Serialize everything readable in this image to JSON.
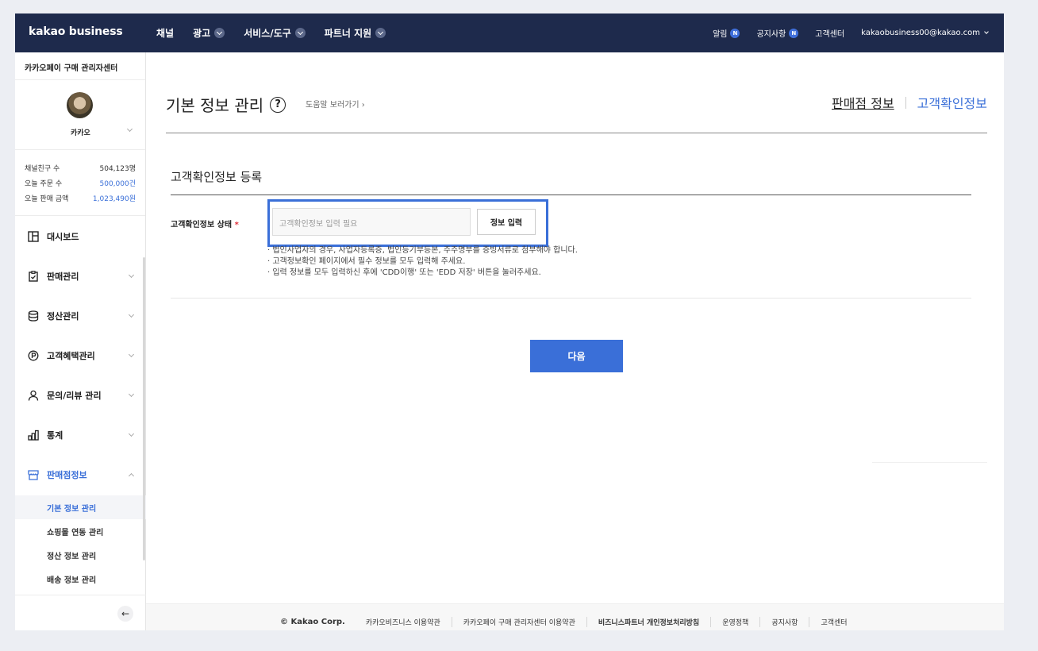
{
  "topnav": {
    "logo": "kakao business",
    "menu": [
      {
        "label": "채널",
        "has_dropdown": false
      },
      {
        "label": "광고",
        "has_dropdown": true
      },
      {
        "label": "서비스/도구",
        "has_dropdown": true
      },
      {
        "label": "파트너 지원",
        "has_dropdown": true
      }
    ],
    "right": {
      "alert": "알림",
      "notice": "공지사항",
      "badge": "N",
      "support": "고객센터",
      "account": "kakaobusiness00@kakao.com"
    }
  },
  "sidebar": {
    "title": "카카오페이 구매 관리자센터",
    "profile_name": "카카오",
    "stats": [
      {
        "label": "채널친구 수",
        "value": "504,123명"
      },
      {
        "label": "오늘 주문 수",
        "value": "500,000건"
      },
      {
        "label": "오늘 판매 금액",
        "value": "1,023,490원"
      }
    ],
    "menu": [
      {
        "label": "대시보드",
        "icon": "dashboard-icon"
      },
      {
        "label": "판매관리",
        "icon": "clipboard-icon"
      },
      {
        "label": "정산관리",
        "icon": "database-icon"
      },
      {
        "label": "고객혜택관리",
        "icon": "point-icon"
      },
      {
        "label": "문의/리뷰 관리",
        "icon": "person-icon"
      },
      {
        "label": "통계",
        "icon": "bar-chart-icon"
      },
      {
        "label": "판매점정보",
        "icon": "store-icon"
      }
    ],
    "submenu": [
      {
        "label": "기본 정보 관리"
      },
      {
        "label": "쇼핑몰 연동 관리"
      },
      {
        "label": "정산 정보 관리"
      },
      {
        "label": "배송 정보 관리"
      }
    ],
    "collapse_glyph": "←"
  },
  "main": {
    "title": "기본 정보 관리",
    "help_glyph": "?",
    "help_link": "도움말 보러가기 ›",
    "tabs": [
      "판매점 정보",
      "고객확인정보"
    ],
    "section_title": "고객확인정보 등록",
    "field_label": "고객확인정보 상태",
    "required_mark": "*",
    "input_placeholder": "고객확인정보 입력 필요",
    "input_button": "정보 입력",
    "notes": [
      "· 법인사업자의 경우, 사업자등록증, 법인등기부등본, 주주명부를 증빙서류로 첨부해야 합니다.",
      "· 고객정보확인 페이지에서 필수 정보를 모두 입력해 주세요.",
      "· 입력 정보를 모두 입력하신 후에 'CDD이행' 또는 'EDD 저장' 버튼을 눌러주세요."
    ],
    "next_button": "다음"
  },
  "footer": {
    "copyright": "© Kakao Corp.",
    "links": [
      "카카오비즈니스 이용약관",
      "카카오페이 구매 관리자센터 이용약관",
      "비즈니스파트너 개인정보처리방침",
      "운영정책",
      "공지사항",
      "고객센터"
    ]
  },
  "colors": {
    "nav_bg": "#1e2a4c",
    "accent": "#3a6fd8",
    "required": "#e0323c"
  }
}
